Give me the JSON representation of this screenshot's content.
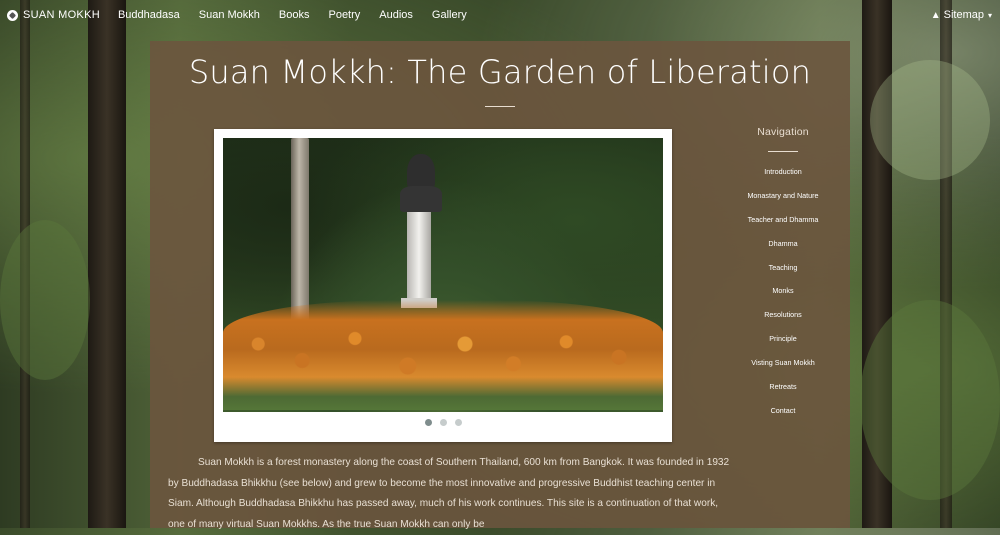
{
  "navbar": {
    "brand": "SUAN MOKKH",
    "links": [
      "Buddhadasa",
      "Suan Mokkh",
      "Books",
      "Poetry",
      "Audios",
      "Gallery"
    ],
    "sitemap_label": "Sitemap",
    "sitemap_icon": "sitemap-icon"
  },
  "page": {
    "title": "Suan Mokkh: The Garden of Liberation"
  },
  "slideshow": {
    "slide_count": 3,
    "active_slide": 1
  },
  "sidenav": {
    "title": "Navigation",
    "items": [
      "Introduction",
      "Monastary and Nature",
      "Teacher and Dhamma",
      "Dhamma",
      "Teaching",
      "Monks",
      "Resolutions",
      "Principle",
      "Visting Suan Mokkh",
      "Retreats",
      "Contact"
    ]
  },
  "intro": {
    "text": "Suan Mokkh is a forest monastery along the coast of Southern Thailand, 600 km from Bangkok. It was founded in 1932 by Buddhadasa Bhikkhu (see below) and grew to become the most innovative and progressive Buddhist teaching center in Siam. Although Buddhadasa Bhikkhu has passed away, much of his work continues. This site is a continuation of that work, one of many virtual Suan Mokkhs. As the true Suan Mokkh can only be"
  },
  "colors": {
    "panel": "#6c553e",
    "text_light": "#e8ddd0",
    "dot_active": "#7f8d8d",
    "dot_inactive": "#c6cccc"
  }
}
